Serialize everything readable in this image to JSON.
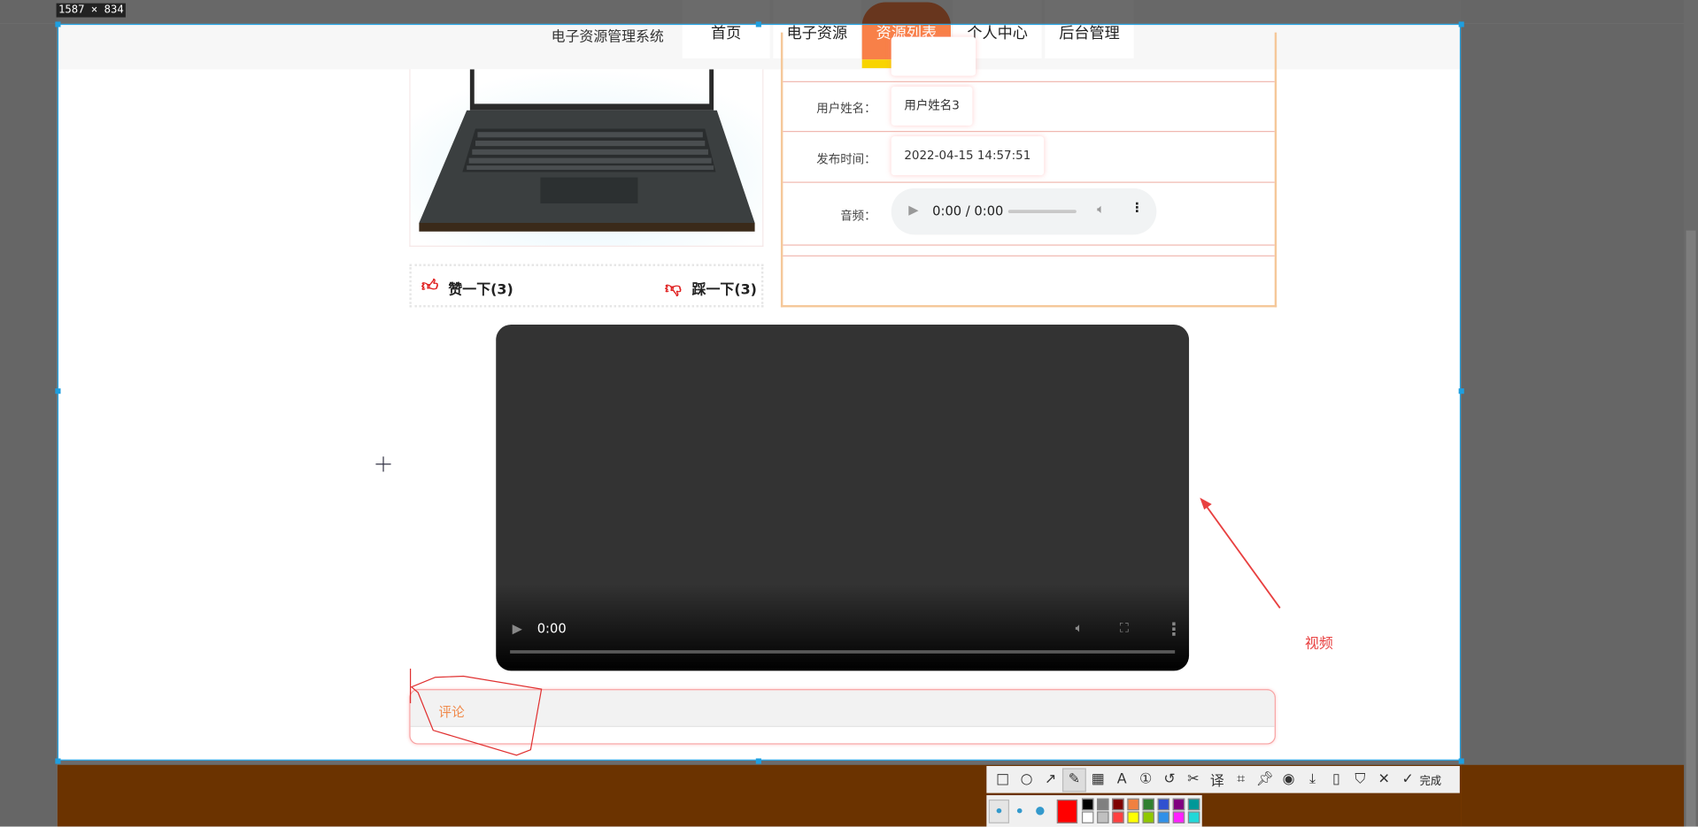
{
  "screen_size_label": "1587 × 834",
  "header": {
    "site_title": "电子资源管理系统",
    "nav": [
      {
        "label": "首页"
      },
      {
        "label": "电子资源"
      },
      {
        "label": "资源列表"
      },
      {
        "label": "个人中心"
      },
      {
        "label": "后台管理"
      }
    ],
    "active": "资源列表"
  },
  "detail": {
    "like_label": "赞一下(3)",
    "dislike_label": "踩一下(3)",
    "fields": [
      {
        "label": "用户姓名：",
        "value": "用户姓名3"
      },
      {
        "label": "发布时间：",
        "value": "2022-04-15 14:57:51"
      }
    ],
    "audio_label": "音频：",
    "audio_time": "0:00 / 0:00",
    "video_time": "0:00"
  },
  "comment": {
    "title": "评论"
  },
  "annotation": {
    "text": "视频",
    "color": "#e84040"
  },
  "toolbar": {
    "done_label": "完成",
    "colors": [
      "#000000",
      "#808080",
      "#800000",
      "#f08040",
      "#308030",
      "#3050d0",
      "#800080",
      "#009898",
      "#ffffff",
      "#c0c0c0",
      "#ff4040",
      "#ffff00",
      "#90c800",
      "#3090e8",
      "#ff20ff",
      "#20d8d8"
    ],
    "current_color": "#ff0000"
  },
  "colors": {
    "accent": "#f88048",
    "accent_bar": "#f8d400",
    "selection": "#1e9fe0",
    "footer": "#ff7a00"
  }
}
